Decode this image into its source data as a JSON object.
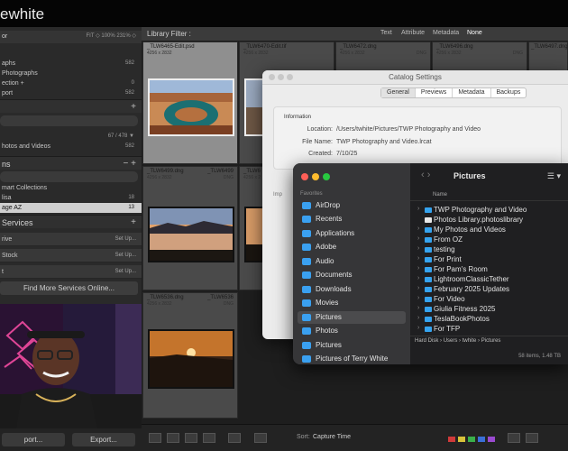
{
  "topbar": {
    "title": "ewhite"
  },
  "left_panel": {
    "navigator": {
      "label": "or",
      "fit": "FIT ◇  100%  231% ◇"
    },
    "catalog_items": [
      {
        "label": "aphs",
        "count": "582"
      },
      {
        "label": "Photographs",
        "count": ""
      },
      {
        "label": "ection +",
        "count": "0"
      },
      {
        "label": "port",
        "count": "582"
      }
    ],
    "folders": {
      "bar_text": "67 / 478  ▼",
      "item": {
        "label": "hotos and Videos",
        "count": "582"
      }
    },
    "collections": {
      "label": "ns",
      "items": [
        {
          "label": "mart Collections",
          "count": ""
        },
        {
          "label": "lisa",
          "count": "18"
        },
        {
          "label": "age AZ",
          "count": "13"
        }
      ]
    },
    "publish": {
      "label": "Services",
      "items": [
        {
          "label": "rive",
          "setup": "Set Up..."
        },
        {
          "label": "Stock",
          "setup": "Set Up..."
        },
        {
          "label": "t",
          "setup": "Set Up..."
        }
      ],
      "find_more": "Find More Services Online..."
    },
    "bottom": {
      "import": "port...",
      "export": "Export..."
    }
  },
  "filter_bar": {
    "label": "Library Filter :",
    "options": [
      "Text",
      "Attribute",
      "Metadata",
      "None"
    ]
  },
  "grid": {
    "cells": [
      {
        "name": "_TLW6465-Edit.psd",
        "dims": "4256 x 2832",
        "ext": "_TLW6465-Edit",
        "type": "PSD"
      },
      {
        "name": "_TLW6470-Edit.tif",
        "dims": "4256 x 2832",
        "ext": "_TLW6470-Edit",
        "type": "TIF"
      },
      {
        "name": "_TLW6472.dng",
        "dims": "4256 x 2832",
        "ext": "_TLW6472",
        "type": "DNG"
      },
      {
        "name": "_TLW6496.dng",
        "dims": "4256 x 2832",
        "ext": "_TLW6496",
        "type": "DNG"
      },
      {
        "name": "_TLW6497.dng",
        "dims": "4256 x 2832",
        "ext": "",
        "type": ""
      },
      {
        "name": "_TLW6499.dng",
        "dims": "4256 x 2832",
        "ext": "_TLW6499",
        "type": "DNG"
      },
      {
        "name": "_TLW6",
        "dims": "4256 x 2",
        "ext": "",
        "type": ""
      },
      {
        "name": "_TLW6536.dng",
        "dims": "4256 x 2832",
        "ext": "_TLW6536",
        "type": "DNG"
      }
    ]
  },
  "toolbar": {
    "sort_label": "Sort:",
    "sort_value": "Capture Time"
  },
  "catalog_settings": {
    "title": "Catalog Settings",
    "tabs": [
      "General",
      "Previews",
      "Metadata",
      "Backups"
    ],
    "section": "Information",
    "location_label": "Location:",
    "location_value": "/Users/twhite/Pictures/TWP Photography and Video",
    "file_label": "File Name:",
    "file_value": "TWP Photography and Video.lrcat",
    "created_label": "Created:",
    "created_value": "7/10/25",
    "partial_label": "Imp"
  },
  "finder": {
    "favorites_label": "Favorites",
    "sidebar": [
      "AirDrop",
      "Recents",
      "Applications",
      "Adobe",
      "Audio",
      "Documents",
      "Downloads",
      "Movies",
      "Pictures",
      "Photos",
      "Pictures",
      "Pictures of Terry White"
    ],
    "title": "Pictures",
    "column": "Name",
    "items": [
      "TWP Photography and Video",
      "Photos Library.photoslibrary",
      "My Photos and Videos",
      "From OZ",
      "testing",
      "For Print",
      "For Pam's Room",
      "LightroomClassicTether",
      "February 2025 Updates",
      "For Video",
      "Giulia Fitness 2025",
      "TeslaBookPhotos",
      "For TFP"
    ],
    "path": [
      "Hard Disk",
      "Users",
      "twhite",
      "Pictures"
    ],
    "status": "58 items, 1.48 TB"
  }
}
